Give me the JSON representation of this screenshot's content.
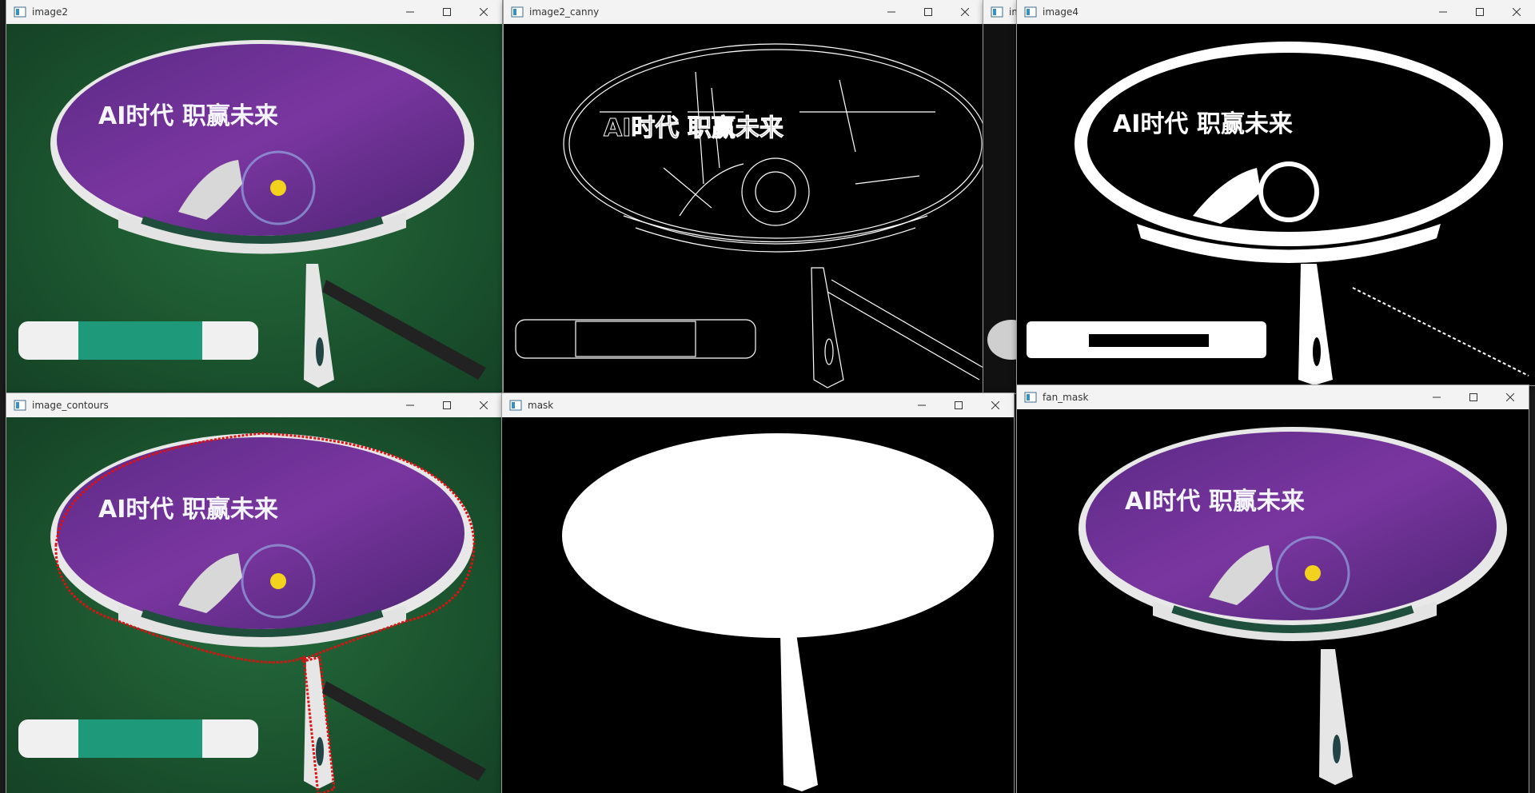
{
  "windows": {
    "image2": {
      "title": "image2"
    },
    "image2_canny": {
      "title": "image2_canny"
    },
    "image3_partial": {
      "title": "im"
    },
    "image4": {
      "title": "image4"
    },
    "image_contours": {
      "title": "image_contours"
    },
    "mask": {
      "title": "mask"
    },
    "fan_mask": {
      "title": "fan_mask"
    }
  },
  "fan": {
    "slogan": "AI时代  职赢未来"
  },
  "icons": {
    "app": "opencv-window-icon",
    "minimize": "minimize-icon",
    "maximize": "maximize-icon",
    "close": "close-icon"
  },
  "colors": {
    "titlebar": "#f3f3f3",
    "fan_purple": "#6a2f8c",
    "background_green": "#1f5a33",
    "contour_red": "#e01010",
    "mask_white": "#ffffff",
    "canvas_black": "#000000"
  }
}
